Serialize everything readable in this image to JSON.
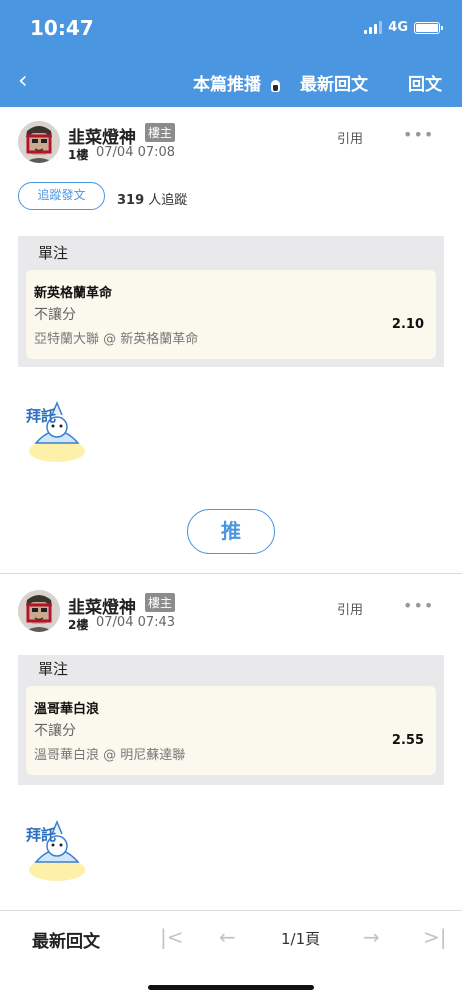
{
  "status_bar": {
    "time": "10:47",
    "network": "4G"
  },
  "nav": {
    "back_icon": "‹",
    "this_post_push": "本篇推播",
    "latest_replies": "最新回文",
    "reply": "回文"
  },
  "posts": [
    {
      "author": "韭菜燈神",
      "badge": "樓主",
      "floor": "1樓",
      "timestamp": "07/04 07:08",
      "quote_label": "引用",
      "more_label": "•••",
      "follow_label": "追蹤發文",
      "follow_count": "319",
      "follow_suffix": "人追蹤",
      "bet": {
        "title": "單注",
        "team": "新英格蘭革命",
        "bet_type": "不讓分",
        "league_match": "亞特蘭大聯 @ 新英格蘭革命",
        "odds": "2.10"
      }
    },
    {
      "author": "韭菜燈神",
      "badge": "樓主",
      "floor": "2樓",
      "timestamp": "07/04 07:43",
      "quote_label": "引用",
      "more_label": "•••",
      "bet": {
        "title": "單注",
        "team": "溫哥華白浪",
        "bet_type": "不讓分",
        "league_match": "溫哥華白浪 @ 明尼蘇達聯",
        "odds": "2.55"
      }
    }
  ],
  "push_button": "推",
  "sticker_text": "拜託",
  "bottom_bar": {
    "latest_label": "最新回文",
    "first_icon": "|<",
    "prev_icon": "←",
    "page_label": "1/1頁",
    "next_icon": "→",
    "last_icon": ">|"
  },
  "colors": {
    "accent": "#4a96e0",
    "bet_box": "#e9e9ec",
    "bet_card": "#fbf9ee"
  },
  "icons": [
    "back-chevron-icon",
    "bulb-icon",
    "signal-icon",
    "battery-icon",
    "more-icon"
  ]
}
